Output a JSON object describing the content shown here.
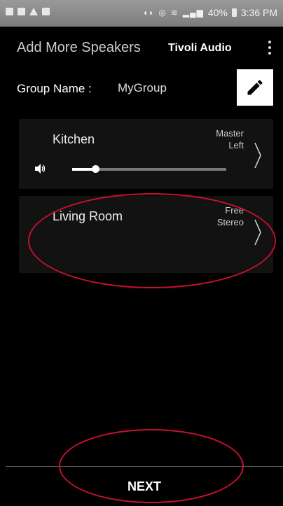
{
  "status_bar": {
    "left_icons": [
      "notification-icon",
      "gallery-icon",
      "warning-icon",
      "app-icon"
    ],
    "right_icons": [
      "mute-icon",
      "alarm-icon",
      "wifi-icon",
      "signal-icon",
      "battery-icon"
    ],
    "battery": "40%",
    "time": "3:36 PM"
  },
  "app_bar": {
    "title": "Add More Speakers",
    "brand": "Tivoli Audio",
    "menu_icon": "overflow-menu-icon"
  },
  "group": {
    "label": "Group Name :",
    "value": "MyGroup",
    "edit_icon": "pencil-icon"
  },
  "speakers": [
    {
      "name": "Kitchen",
      "mode_line1": "Master",
      "mode_line2": "Left",
      "volume": 0.15
    },
    {
      "name": "Living Room",
      "mode_line1": "Free",
      "mode_line2": "Stereo"
    }
  ],
  "footer": {
    "next_label": "NEXT"
  },
  "colors": {
    "annotation": "#c8102e",
    "background": "#000000",
    "card": "#121212"
  }
}
